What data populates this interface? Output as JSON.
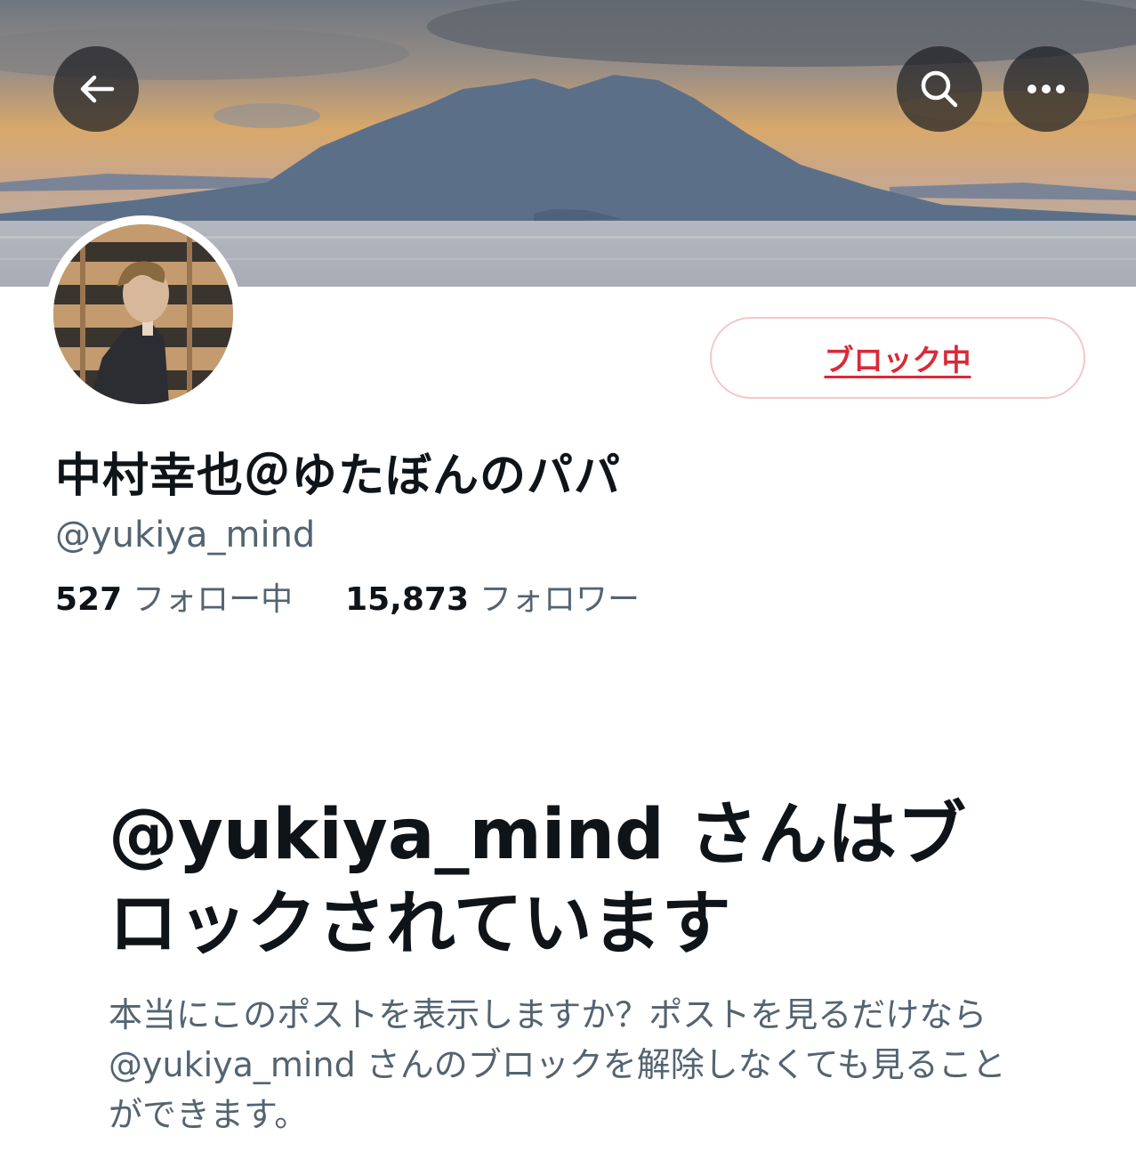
{
  "header": {
    "back_icon": "arrow-left-icon",
    "search_icon": "search-icon",
    "more_icon": "more-horizontal-icon"
  },
  "profile": {
    "display_name": "中村幸也＠ゆたぼんのパパ",
    "handle": "@yukiya_mind",
    "following_count": "527",
    "following_label": "フォロー中",
    "followers_count": "15,873",
    "followers_label": "フォロワー",
    "block_button_label": "ブロック中"
  },
  "blocked_notice": {
    "title": "@yukiya_mind さんはブロックされています",
    "description": "本当にこのポストを表示しますか？ポストを見るだけなら @yukiya_mind さんのブロックを解除しなくても見ることができます。"
  },
  "colors": {
    "block_red": "#d92a38",
    "secondary_text": "#536471",
    "primary_text": "#0f1419"
  }
}
